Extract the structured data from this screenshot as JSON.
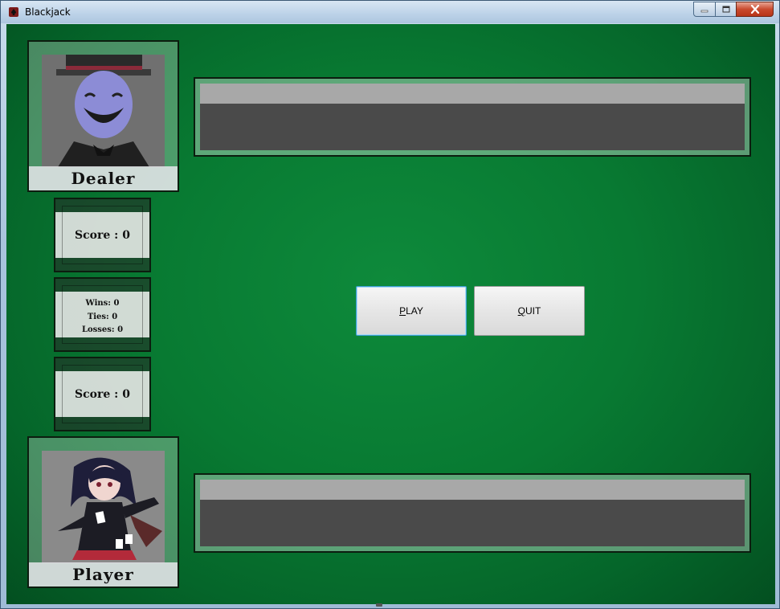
{
  "window": {
    "title": "Blackjack",
    "controls": {
      "minimize": "minimize",
      "maximize": "maximize",
      "close": "close"
    }
  },
  "dealer": {
    "caption": "Dealer"
  },
  "player": {
    "caption": "Player"
  },
  "dealer_score": {
    "label": "Score : 0"
  },
  "player_score": {
    "label": "Score : 0"
  },
  "stats": {
    "wins": "Wins: 0",
    "ties": "Ties: 0",
    "losses": "Losses: 0"
  },
  "buttons": {
    "play": {
      "mnemonic": "P",
      "rest": "LAY"
    },
    "quit": {
      "pre": "",
      "mnemonic": "Q",
      "rest": "UIT"
    }
  },
  "colors": {
    "table_felt": "#087a32",
    "panel_border": "#0c1d0f",
    "zone_bar": "#a8a8a8",
    "zone_pit": "#4a4a4a",
    "play_focus": "#3c9fd1"
  },
  "icons": {
    "app": "card-spade-icon",
    "minimize": "minimize-icon",
    "maximize": "maximize-icon",
    "close": "close-icon"
  }
}
